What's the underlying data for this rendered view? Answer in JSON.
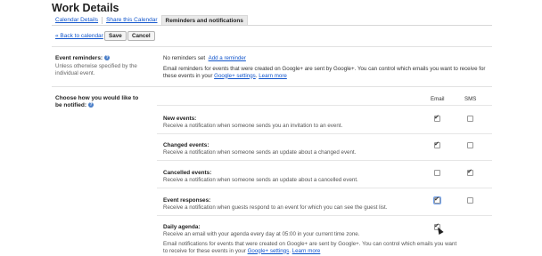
{
  "page_title": "Work Details",
  "tabs": [
    {
      "label": "Calendar Details"
    },
    {
      "label": "Share this Calendar"
    },
    {
      "label": "Reminders and notifications"
    }
  ],
  "toolbar": {
    "back_label": "« Back to calendar",
    "save_label": "Save",
    "cancel_label": "Cancel"
  },
  "reminders": {
    "label": "Event reminders:",
    "help_icon": "?",
    "sub": "Unless otherwise specified by the individual event.",
    "status": "No reminders set",
    "add_link": "Add a reminder",
    "info_prefix": "Email reminders for events that were created on Google+ are sent by Google+. You can control which emails you want to receive for these events in your",
    "info_link1": "Google+ settings",
    "info_link2": "Learn more"
  },
  "notify": {
    "label": "Choose how you would like to be notified:",
    "col_email": "Email",
    "col_sms": "SMS",
    "events": [
      {
        "title": "New events:",
        "desc": "Receive a notification when someone sends you an invitation to an event.",
        "email": true,
        "sms": false
      },
      {
        "title": "Changed events:",
        "desc": "Receive a notification when someone sends an update about a changed event.",
        "email": true,
        "sms": false
      },
      {
        "title": "Cancelled events:",
        "desc": "Receive a notification when someone sends an update about a cancelled event.",
        "email": false,
        "sms": true
      },
      {
        "title": "Event responses:",
        "desc": "Receive a notification when guests respond to an event for which you can see the guest list.",
        "email": true,
        "sms": false
      },
      {
        "title": "Daily agenda:",
        "desc": "Receive an email with your agenda every day at 05:00 in your current time zone.",
        "email": true,
        "sms": null
      }
    ],
    "footer_prefix": "Email notifications for events that were created on Google+ are sent by Google+. You can control which emails you want to receive for these events in your",
    "footer_link1": "Google+ settings",
    "footer_link2": "Learn more"
  }
}
